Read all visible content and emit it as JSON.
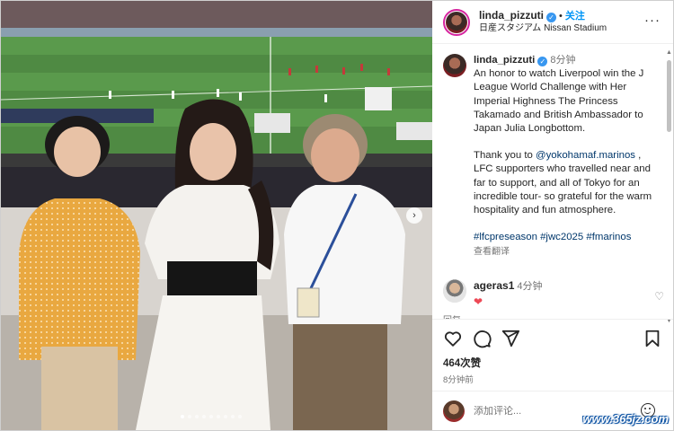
{
  "header": {
    "username": "linda_pizzuti",
    "follow_label": "关注",
    "separator": "•",
    "location": "日産スタジアム Nissan Stadium",
    "more_icon": "more-horizontal-icon"
  },
  "caption": {
    "username": "linda_pizzuti",
    "time": "8分钟",
    "text_1": "An honor to watch Liverpool win the J League World Challenge with Her Imperial Highness The Princess Takamado and British Ambassador to Japan Julia Longbottom.",
    "text_2_pre": "Thank you to ",
    "mention": "@yokohamaf.marinos",
    "text_2_post": " , LFC supporters who travelled near and far to support, and all of Tokyo for an incredible tour- so grateful for the warm hospitality and fun atmosphere.",
    "hashtags": "#lfcpreseason #jwc2025 #fmarinos",
    "translate_label": "查看翻译"
  },
  "comment": {
    "username": "ageras1",
    "time": "4分钟",
    "text": "❤",
    "reply_label": "回复"
  },
  "actions": {
    "likes": "464次赞",
    "post_time": "8分钟前"
  },
  "add_comment": {
    "placeholder": "添加评论..."
  },
  "watermark": "www.365jz.com",
  "colors": {
    "link": "#00376b",
    "follow": "#0095f6",
    "verified": "#3897f0",
    "heart": "#ed4956",
    "story_ring": "#d6249f"
  },
  "carousel": {
    "slide_count": 9,
    "active_slide": 1,
    "next_icon": "chevron-right-icon"
  }
}
